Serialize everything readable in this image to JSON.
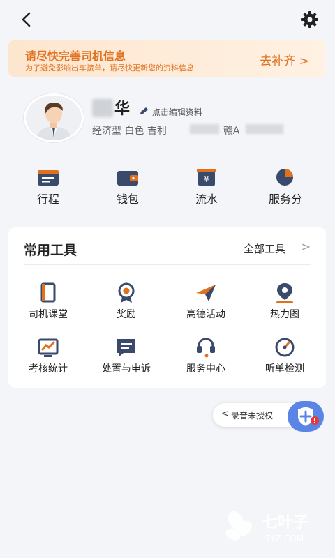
{
  "header": {
    "back_icon": "chevron-left-icon",
    "settings_icon": "gear-icon"
  },
  "banner": {
    "title": "请尽快完善司机信息",
    "subtitle": "为了避免影响出车接单，请尽快更新您的资料信息",
    "action": "去补齐 >"
  },
  "profile": {
    "name": "华",
    "edit_label": "点击编辑资料",
    "car_type": "经济型",
    "car_color": "白色",
    "car_brand": "吉利",
    "plate_prefix": "赣A"
  },
  "quick_links": [
    {
      "label": "行程",
      "icon": "trip-icon"
    },
    {
      "label": "钱包",
      "icon": "wallet-icon"
    },
    {
      "label": "流水",
      "icon": "cashflow-icon"
    },
    {
      "label": "服务分",
      "icon": "service-score-icon"
    }
  ],
  "tools": {
    "title": "常用工具",
    "all_label": "全部工具",
    "chevron": ">",
    "items": [
      {
        "label": "司机课堂",
        "icon": "book-icon"
      },
      {
        "label": "奖励",
        "icon": "medal-icon"
      },
      {
        "label": "高德活动",
        "icon": "paper-plane-icon"
      },
      {
        "label": "热力图",
        "icon": "location-pin-icon"
      },
      {
        "label": "考核统计",
        "icon": "chart-icon"
      },
      {
        "label": "处置与申诉",
        "icon": "message-icon"
      },
      {
        "label": "服务中心",
        "icon": "headset-icon"
      },
      {
        "label": "听单检测",
        "icon": "gauge-icon"
      }
    ]
  },
  "recording": {
    "label": "录音未授权",
    "arrow": "<"
  },
  "watermark": {
    "text_cn": "七叶子",
    "text_en": "7YZ.COM"
  },
  "colors": {
    "accent_orange": "#e0721f",
    "navy": "#3a4a6b",
    "blue": "#5a84e6"
  }
}
